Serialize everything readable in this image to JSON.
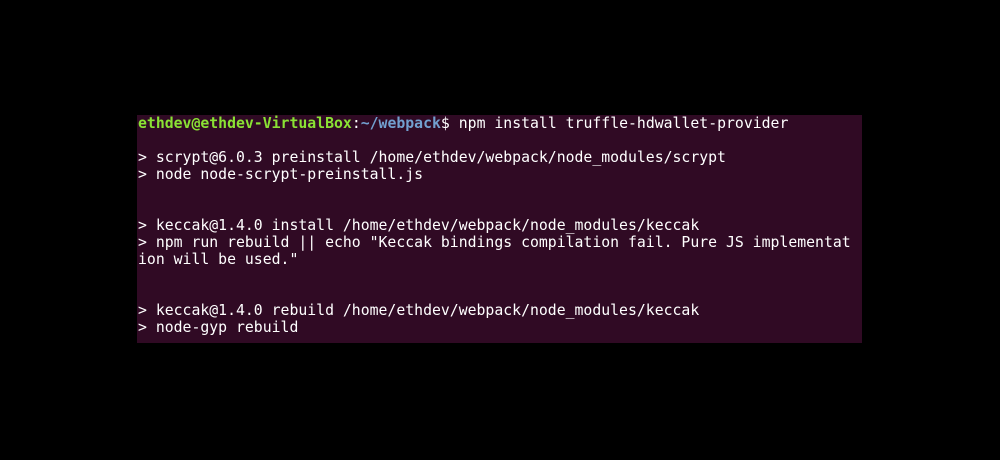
{
  "terminal": {
    "prompt": {
      "user_host": "ethdev@ethdev-VirtualBox",
      "separator": ":",
      "path": "~/webpack",
      "symbol": "$",
      "command": " npm install truffle-hdwallet-provider"
    },
    "output": [
      "> scrypt@6.0.3 preinstall /home/ethdev/webpack/node_modules/scrypt",
      "> node node-scrypt-preinstall.js",
      "> keccak@1.4.0 install /home/ethdev/webpack/node_modules/keccak",
      "> npm run rebuild || echo \"Keccak bindings compilation fail. Pure JS implementat",
      "ion will be used.\"",
      "> keccak@1.4.0 rebuild /home/ethdev/webpack/node_modules/keccak",
      "> node-gyp rebuild"
    ]
  },
  "colors": {
    "background": "#000000",
    "terminal_background": "#300a24",
    "prompt_user": "#8ae234",
    "prompt_path": "#729fcf",
    "text": "#ffffff"
  }
}
